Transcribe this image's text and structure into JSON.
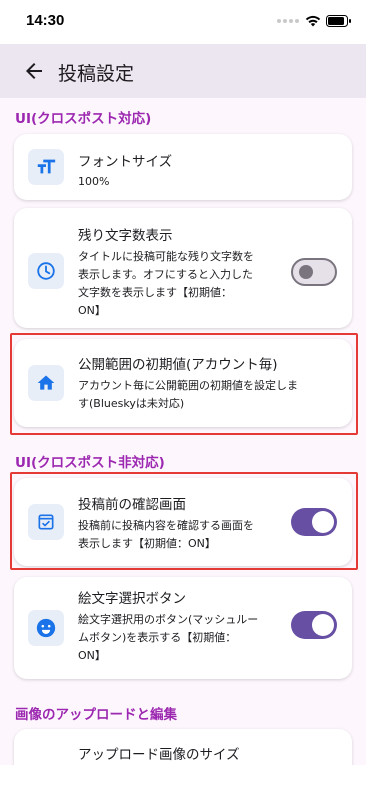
{
  "status_bar": {
    "time": "14:30"
  },
  "header": {
    "title": "投稿設定",
    "back_icon": "arrow-back-icon"
  },
  "sections": [
    {
      "title": "UI(クロスポスト対応)"
    },
    {
      "title": "UI(クロスポスト非対応)"
    },
    {
      "title": "画像のアップロードと編集"
    }
  ],
  "settings": {
    "font_size": {
      "title": "フォントサイズ",
      "value": "100%",
      "icon": "text-size-icon"
    },
    "char_count": {
      "title": "残り文字数表示",
      "desc": [
        "タイトルに投稿可能な残り文字数を",
        "表示します。オフにすると入力した",
        "文字数を表示します【初期値：",
        "ON】"
      ],
      "icon": "clock-icon",
      "toggle": "off"
    },
    "visibility": {
      "title": "公開範囲の初期値(アカウント毎)",
      "desc": [
        "アカウント毎に公開範囲の初期値を設定しま",
        "す(Blueskyは未対応)"
      ],
      "icon": "home-icon"
    },
    "confirm": {
      "title": "投稿前の確認画面",
      "desc": [
        "投稿前に投稿内容を確認する画面を",
        "表示します【初期値：ON】"
      ],
      "icon": "confirm-icon",
      "toggle": "on"
    },
    "emoji": {
      "title": "絵文字選択ボタン",
      "desc": [
        "絵文字選択用のボタン(マッシュルー",
        "ムボタン)を表示する【初期値：",
        "ON】"
      ],
      "icon": "emoji-icon",
      "toggle": "on"
    },
    "upload_size": {
      "title": "アップロード画像のサイズ"
    }
  },
  "colors": {
    "accent": "#6750a4",
    "section_header": "#9c27b0",
    "icon": "#1a73e8",
    "highlight": "#e53935"
  }
}
